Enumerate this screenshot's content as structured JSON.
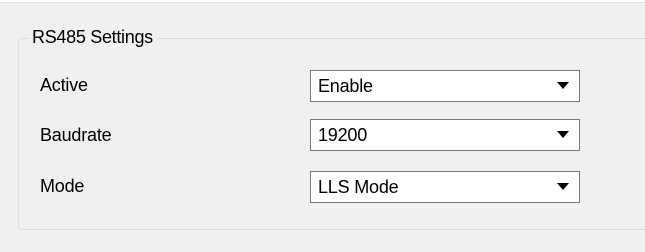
{
  "groupbox": {
    "title": "RS485 Settings"
  },
  "fields": [
    {
      "label": "Active",
      "value": "Enable"
    },
    {
      "label": "Baudrate",
      "value": "19200"
    },
    {
      "label": "Mode",
      "value": "LLS Mode"
    }
  ],
  "icons": {
    "dropdown": "chevron-down-icon"
  }
}
